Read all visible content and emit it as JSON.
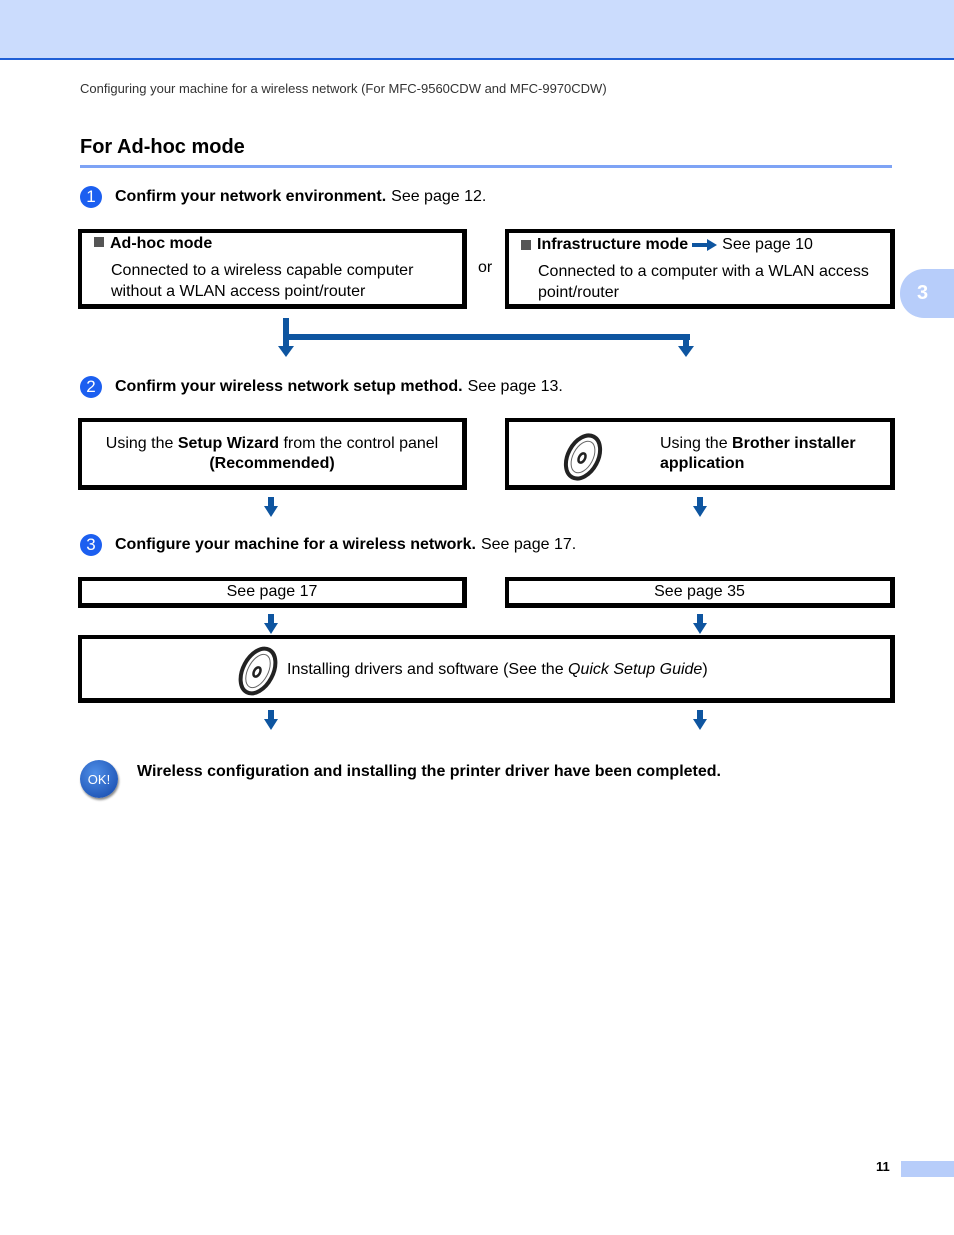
{
  "header": {
    "running_head": "Configuring your machine for a wireless network (For MFC-9560CDW and MFC-9970CDW)",
    "chapter_tab": "3"
  },
  "section": {
    "title": "For Ad-hoc mode"
  },
  "steps": [
    {
      "number": "1",
      "bold": "Confirm your network environment.",
      "rest": "See page 12."
    },
    {
      "number": "2",
      "bold": "Confirm your wireless network setup method.",
      "rest": "See page 13."
    },
    {
      "number": "3",
      "bold": "Configure your machine for a wireless network.",
      "rest": "See page 17."
    }
  ],
  "environment": {
    "adhoc": {
      "title": "Ad-hoc mode",
      "line1": "Connected to a wireless capable computer",
      "line2": "without a WLAN access point/router"
    },
    "or_label": "or",
    "infra": {
      "title": "Infrastructure mode",
      "see": "See page 10",
      "line1": "Connected to a computer with a WLAN access",
      "line2": "point/router"
    }
  },
  "methods": {
    "wizard": {
      "pre": "Using the ",
      "bold": "Setup Wizard",
      "post": " from the control panel",
      "line2": "(Recommended)"
    },
    "installer": {
      "pre": "Using the ",
      "bold1": "Brother installer",
      "bold2": "application"
    }
  },
  "configure": {
    "left": "See page 17",
    "right": "See page 35"
  },
  "install": {
    "pre": "Installing drivers and software (See the ",
    "italic": "Quick Setup Guide",
    "post": ")"
  },
  "completion": {
    "badge": "OK!",
    "text": "Wireless configuration and installing the printer driver have been completed."
  },
  "footer": {
    "page_number": "11"
  },
  "colors": {
    "arrow": "#0e55a0",
    "step_circle": "#1c5ff0",
    "band": "#cbdcfd"
  }
}
